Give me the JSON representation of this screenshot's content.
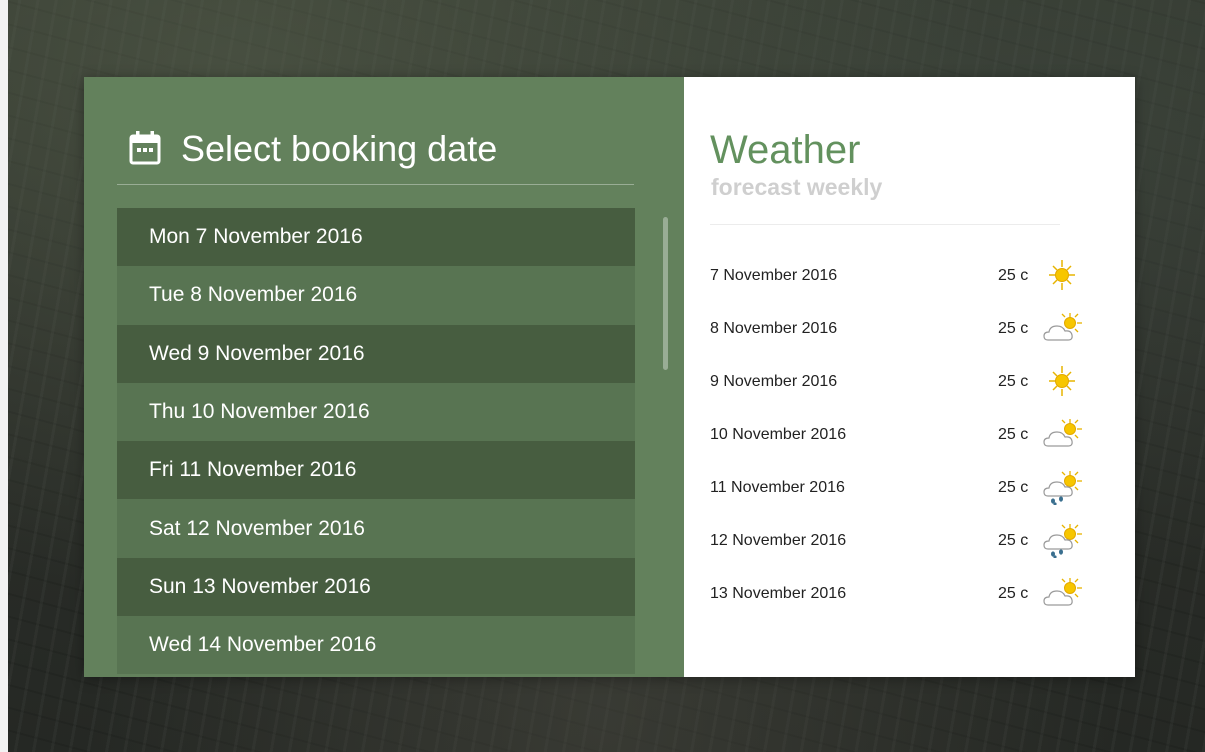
{
  "booking": {
    "title": "Select booking date",
    "icon": "calendar-icon",
    "dates": [
      {
        "label": "Mon 7 November 2016"
      },
      {
        "label": "Tue 8 November 2016"
      },
      {
        "label": "Wed 9 November 2016"
      },
      {
        "label": "Thu 10 November 2016"
      },
      {
        "label": "Fri 11 November 2016"
      },
      {
        "label": "Sat 12 November 2016"
      },
      {
        "label": "Sun 13 November 2016"
      },
      {
        "label": "Wed 14 November 2016"
      }
    ]
  },
  "weather": {
    "title": "Weather",
    "subtitle": "forecast weekly",
    "forecast": [
      {
        "date": "7 November 2016",
        "temp": "25 c",
        "icon": "sunny-icon"
      },
      {
        "date": "8 November 2016",
        "temp": "25 c",
        "icon": "partly-cloudy-icon"
      },
      {
        "date": "9 November 2016",
        "temp": "25 c",
        "icon": "sunny-icon"
      },
      {
        "date": "10 November 2016",
        "temp": "25 c",
        "icon": "partly-cloudy-icon"
      },
      {
        "date": "11 November 2016",
        "temp": "25 c",
        "icon": "rain-sun-icon"
      },
      {
        "date": "12 November 2016",
        "temp": "25 c",
        "icon": "rain-sun-icon"
      },
      {
        "date": "13 November 2016",
        "temp": "25 c",
        "icon": "partly-cloudy-icon"
      }
    ]
  },
  "colors": {
    "left_panel": "#63815c",
    "row_dark": "#475d40",
    "row_light": "#587452",
    "weather_title": "#63915e",
    "sun": "#f7c600",
    "rain": "#3a6f8f"
  }
}
